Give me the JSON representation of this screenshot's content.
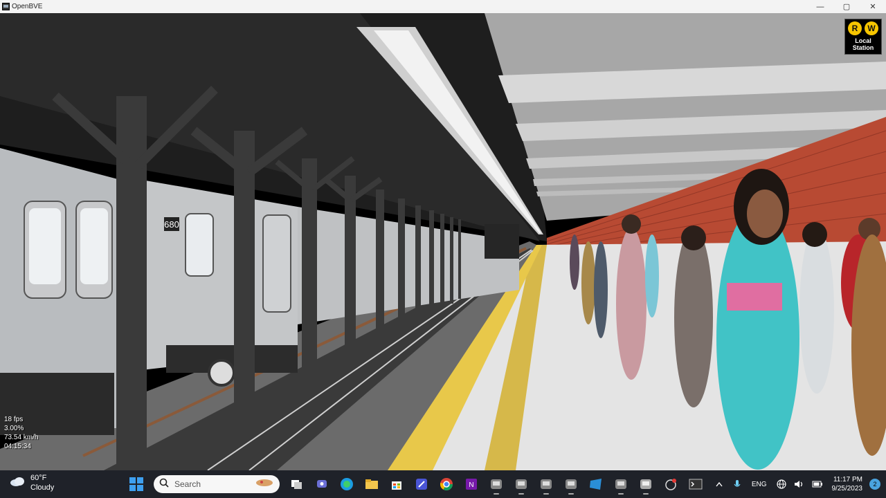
{
  "window": {
    "title": "OpenBVE",
    "minimize_glyph": "—",
    "maximize_glyph": "▢",
    "close_glyph": "✕"
  },
  "sign": {
    "routes": [
      "R",
      "W"
    ],
    "line1": "Local",
    "line2": "Station",
    "bullet_color": "#f6c500"
  },
  "train": {
    "car_number": "680"
  },
  "hud": {
    "fps": "18 fps",
    "throttle": "3.00%",
    "speed": "73.54 km/h",
    "time": "04:15:34"
  },
  "taskbar": {
    "weather_temp": "60°F",
    "weather_desc": "Cloudy",
    "search_placeholder": "Search",
    "lang": "ENG",
    "time": "11:17 PM",
    "date": "9/25/2023",
    "notifications": "2"
  },
  "colors": {
    "accent_yellow": "#e8c84a",
    "brick": "#b84a33",
    "taskbar_bg": "#1f2229"
  }
}
